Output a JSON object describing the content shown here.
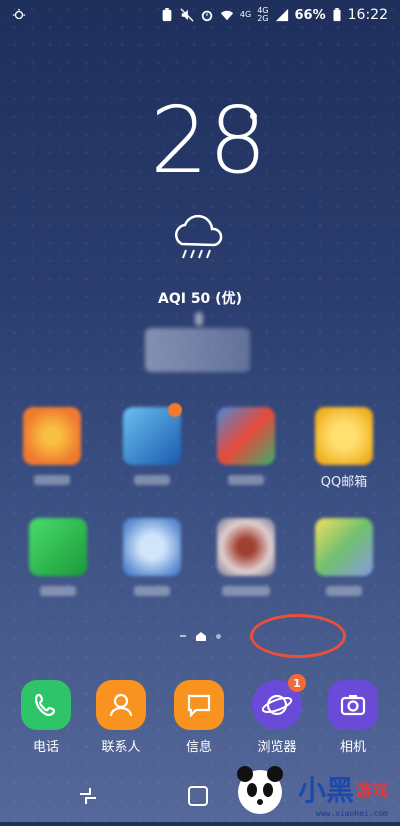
{
  "status_bar": {
    "network_labels": [
      "4G",
      "4G",
      "2G"
    ],
    "battery_percent": "66%",
    "time": "16:22"
  },
  "weather": {
    "temperature": "28",
    "degree_symbol": "°",
    "aqi": "AQI 50 (优)"
  },
  "app_grid": [
    {
      "label": "",
      "color": "#f08a3a"
    },
    {
      "label": "",
      "color": "#3a8ad8"
    },
    {
      "label": "",
      "color": "#3a6ad8"
    },
    {
      "label": "QQ邮箱",
      "color": "#f0c030"
    },
    {
      "label": "",
      "color": "#2aaa4a"
    },
    {
      "label": "",
      "color": "#7aa4e0"
    },
    {
      "label": "",
      "color": "#c4a0a0"
    },
    {
      "label": "",
      "color": "#a0c070"
    }
  ],
  "dock": [
    {
      "label": "电话",
      "icon": "phone-icon",
      "color": "#2ec56a"
    },
    {
      "label": "联系人",
      "icon": "contact-icon",
      "color": "#f7931e"
    },
    {
      "label": "信息",
      "icon": "message-icon",
      "color": "#f7931e"
    },
    {
      "label": "浏览器",
      "icon": "browser-icon",
      "color": "#6a4bd8",
      "badge": "1"
    },
    {
      "label": "相机",
      "icon": "camera-icon",
      "color": "#6a4bd8"
    }
  ],
  "watermark": {
    "site": "www.xiaohei.com"
  }
}
